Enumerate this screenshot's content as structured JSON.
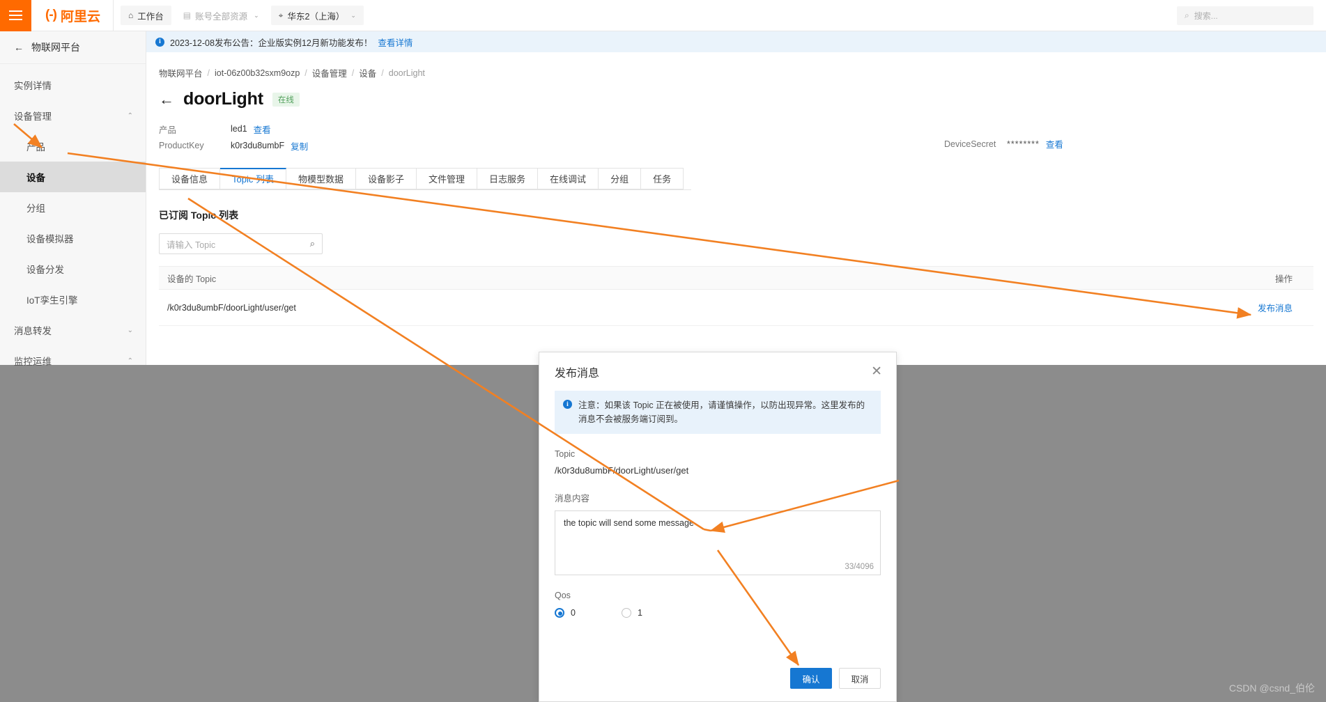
{
  "topbar": {
    "menu_icon": "hamburger-icon",
    "brand_mark": "(-)",
    "brand_text": "阿里云",
    "nav": [
      {
        "icon": "home-icon",
        "label": "工作台",
        "caret": false
      },
      {
        "icon": "resources-icon",
        "label": "账号全部资源",
        "caret": true
      },
      {
        "icon": "location-icon",
        "label": "华东2（上海）",
        "caret": true
      }
    ],
    "search_placeholder": "搜索...",
    "search_icon": "search-icon"
  },
  "sidebar": {
    "header": {
      "label": "物联网平台",
      "back_icon": "back-arrow-icon"
    },
    "items": [
      {
        "label": "实例详情",
        "level": "top",
        "chevron": "",
        "active": false
      },
      {
        "label": "设备管理",
        "level": "top",
        "chevron": "⌃",
        "active": false
      },
      {
        "label": "产品",
        "level": "sub",
        "chevron": "",
        "active": false
      },
      {
        "label": "设备",
        "level": "sub",
        "chevron": "",
        "active": true
      },
      {
        "label": "分组",
        "level": "sub",
        "chevron": "",
        "active": false
      },
      {
        "label": "设备模拟器",
        "level": "sub",
        "chevron": "",
        "active": false
      },
      {
        "label": "设备分发",
        "level": "sub",
        "chevron": "",
        "active": false
      },
      {
        "label": "IoT孪生引擎",
        "level": "sub",
        "chevron": "",
        "active": false
      },
      {
        "label": "消息转发",
        "level": "top",
        "chevron": "⌄",
        "active": false
      },
      {
        "label": "监控运维",
        "level": "top",
        "chevron": "⌃",
        "active": false
      }
    ]
  },
  "notice": {
    "icon": "info-icon",
    "text": "2023-12-08发布公告：企业版实例12月新功能发布！",
    "link": "查看详情"
  },
  "breadcrumb": [
    "物联网平台",
    "iot-06z00b32sxm9ozp",
    "设备管理",
    "设备",
    "doorLight"
  ],
  "page": {
    "back_icon": "back-arrow-icon",
    "title": "doorLight",
    "status_badge": "在线"
  },
  "device_meta": {
    "rows": [
      {
        "key": "产品",
        "value": "led1",
        "link": "查看"
      },
      {
        "key": "ProductKey",
        "value": "k0r3du8umbF",
        "link": "复制"
      }
    ],
    "secret": {
      "key": "DeviceSecret",
      "value": "********",
      "link": "查看"
    }
  },
  "tabs": [
    {
      "label": "设备信息",
      "active": false
    },
    {
      "label": "Topic 列表",
      "active": true
    },
    {
      "label": "物模型数据",
      "active": false
    },
    {
      "label": "设备影子",
      "active": false
    },
    {
      "label": "文件管理",
      "active": false
    },
    {
      "label": "日志服务",
      "active": false
    },
    {
      "label": "在线调试",
      "active": false
    },
    {
      "label": "分组",
      "active": false
    },
    {
      "label": "任务",
      "active": false
    }
  ],
  "topic_section": {
    "title": "已订阅 Topic 列表",
    "search_placeholder": "请输入 Topic",
    "search_icon": "search-icon",
    "columns": [
      "设备的 Topic",
      "操作"
    ],
    "rows": [
      {
        "topic": "/k0r3du8umbF/doorLight/user/get",
        "action": "发布消息"
      }
    ]
  },
  "modal": {
    "title": "发布消息",
    "close_icon": "close-icon",
    "alert": {
      "icon": "info-icon",
      "text": "注意：如果该 Topic 正在被使用，请谨慎操作，以防出现异常。这里发布的消息不会被服务端订阅到。"
    },
    "topic_label": "Topic",
    "topic_value": "/k0r3du8umbF/doorLight/user/get",
    "message_label": "消息内容",
    "message_value": "the topic will send some message",
    "message_counter": "33/4096",
    "qos_label": "Qos",
    "qos_options": [
      {
        "label": "0",
        "selected": true
      },
      {
        "label": "1",
        "selected": false
      }
    ],
    "confirm_label": "确认",
    "cancel_label": "取消"
  },
  "watermark": "CSDN @csnd_伯伦",
  "colors": {
    "brand_orange": "#ff6a00",
    "link_blue": "#1677d2",
    "annotation_orange": "#f28022",
    "online_green": "#52a05c"
  }
}
